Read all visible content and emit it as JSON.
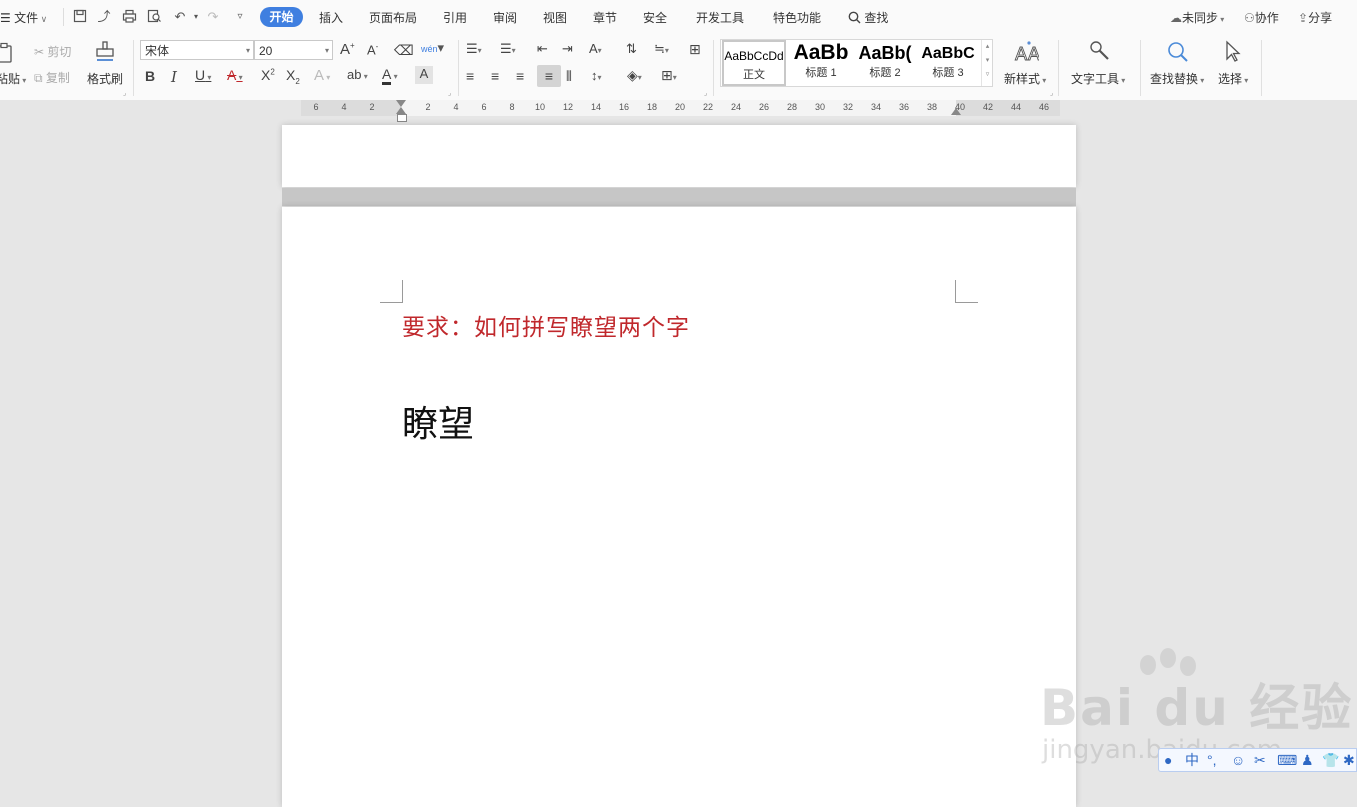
{
  "menubar": {
    "file_label": "文件",
    "tabs": [
      "开始",
      "插入",
      "页面布局",
      "引用",
      "审阅",
      "视图",
      "章节",
      "安全",
      "开发工具",
      "特色功能"
    ],
    "search_label": "查找",
    "sync_label": "未同步",
    "collab_label": "协作",
    "share_label": "分享"
  },
  "ribbon": {
    "paste_label": "粘贴",
    "cut_label": "剪切",
    "copy_label": "复制",
    "format_painter_label": "格式刷",
    "font_name": "宋体",
    "font_size": "20",
    "styles": [
      {
        "preview": "AaBbCcDd",
        "name": "正文"
      },
      {
        "preview": "AaBb",
        "name": "标题 1"
      },
      {
        "preview": "AaBb(",
        "name": "标题 2"
      },
      {
        "preview": "AaBbC",
        "name": "标题 3"
      }
    ],
    "new_style_label": "新样式",
    "text_tools_label": "文字工具",
    "find_replace_label": "查找替换",
    "select_label": "选择"
  },
  "ruler": {
    "ticks": [
      "6",
      "4",
      "2",
      "2",
      "4",
      "6",
      "8",
      "10",
      "12",
      "14",
      "16",
      "18",
      "20",
      "22",
      "24",
      "26",
      "28",
      "30",
      "32",
      "34",
      "36",
      "38",
      "40",
      "42",
      "44",
      "46"
    ]
  },
  "document": {
    "requirement_text": "要求：如何拼写瞭望两个字",
    "word_text": "瞭望",
    "requirement_color": "#c0282c"
  },
  "watermark": {
    "logo_text": "Bai du 经验",
    "url_text": "jingyan.baidu.com"
  },
  "colors": {
    "accent": "#3f7fe0",
    "page": "#ffffff",
    "canvas": "#e6e6e6"
  }
}
